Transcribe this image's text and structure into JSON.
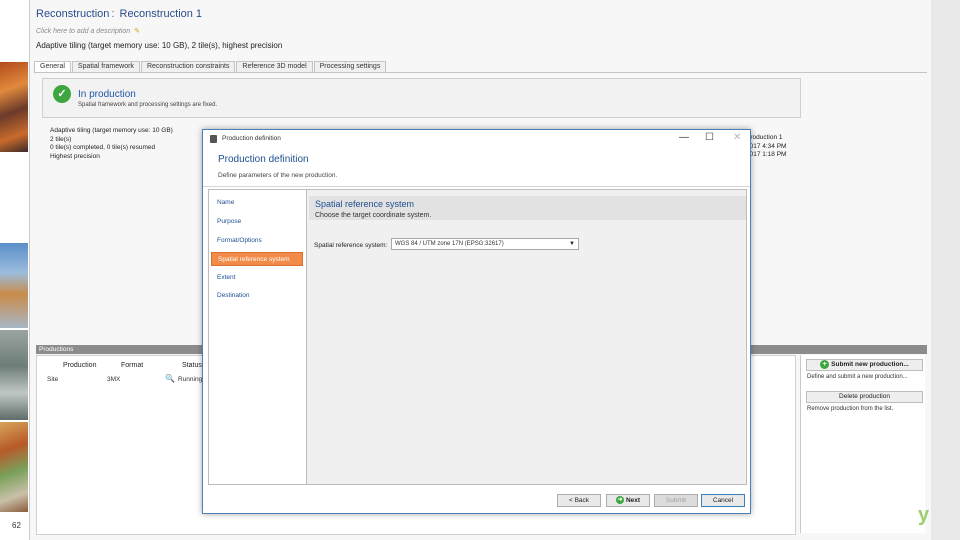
{
  "slide": {
    "page_number": "62"
  },
  "app": {
    "title_part1": "Reconstruction",
    "title_sep": ":",
    "title_part2": "Reconstruction 1",
    "edit_hint": "Click here to add a description",
    "subline": "Adaptive tiling (target memory use: 10 GB), 2 tile(s), highest precision"
  },
  "tabs": [
    "General",
    "Spatial framework",
    "Reconstruction constraints",
    "Reference 3D model",
    "Processing settings"
  ],
  "banner": {
    "title": "In production",
    "subtitle": "Spatial framework and processing settings are fixed."
  },
  "info_left": [
    "Adaptive tiling (target memory use: 10 GB)",
    "2 tile(s)",
    "0 tile(s) completed, 0 tile(s) resumed",
    "Highest precision"
  ],
  "info_right": [
    "Production 1",
    "2017 4:34 PM",
    "2017 1:18 PM"
  ],
  "productions": {
    "header": "Productions",
    "columns": [
      "Production",
      "Format",
      "Status"
    ],
    "rows": [
      {
        "name": "Site",
        "format": "3MX",
        "status": "Running"
      }
    ],
    "submit_label": "Submit new production...",
    "submit_desc": "Define and submit a new production...",
    "delete_label": "Delete production",
    "delete_desc": "Remove production from the list."
  },
  "dialog": {
    "window_title": "Production definition",
    "header": "Production definition",
    "subheader": "Define parameters of the new production.",
    "nav": [
      "Name",
      "Purpose",
      "Format/Options",
      "Spatial reference system",
      "Extent",
      "Destination"
    ],
    "active_nav_index": 3,
    "section_title": "Spatial reference system",
    "section_sub": "Choose the target coordinate system.",
    "srs_label": "Spatial reference system:",
    "srs_value": "WGS 84 / UTM zone 17N (EPSG:32617)",
    "buttons": {
      "back": "< Back",
      "next": "Next",
      "submit": "Submit",
      "cancel": "Cancel"
    }
  },
  "colors": {
    "accent_orange": "#f28a48",
    "title_blue": "#1f4f8f",
    "ok_green": "#3ea63e"
  },
  "icons": [
    "check-icon",
    "pencil-icon",
    "magnifier-icon",
    "plus-icon",
    "next-arrow-icon",
    "window-minimize-icon",
    "window-maximize-icon",
    "window-close-icon",
    "dropdown-arrow-icon"
  ]
}
